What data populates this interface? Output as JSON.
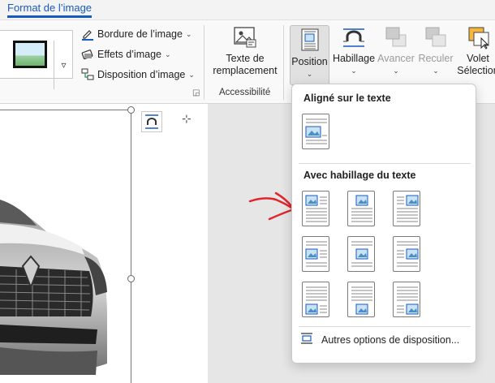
{
  "tab": {
    "label": "Format de l’image"
  },
  "ribbon": {
    "styles_more": "▿",
    "border_label": "Bordure de l’image",
    "effects_label": "Effets d’image",
    "layout_label": "Disposition d’image",
    "alt_text_line1": "Texte de",
    "alt_text_line2": "remplacement",
    "accessibility_group": "Accessibilité",
    "position_label": "Position",
    "wrap_label": "Habillage",
    "forward_label": "Avancer",
    "backward_label": "Reculer",
    "selection_line1": "Volet",
    "selection_line2": "Sélection",
    "chevron": "⌄"
  },
  "position_menu": {
    "inline_heading": "Aligné sur le texte",
    "wrap_heading": "Avec habillage du texte",
    "more_options": "Autres options de disposition..."
  },
  "document": {
    "comment_glyph": "⊹"
  },
  "colors": {
    "accent": "#185abd",
    "annotation_arrow": "#e0262b"
  }
}
